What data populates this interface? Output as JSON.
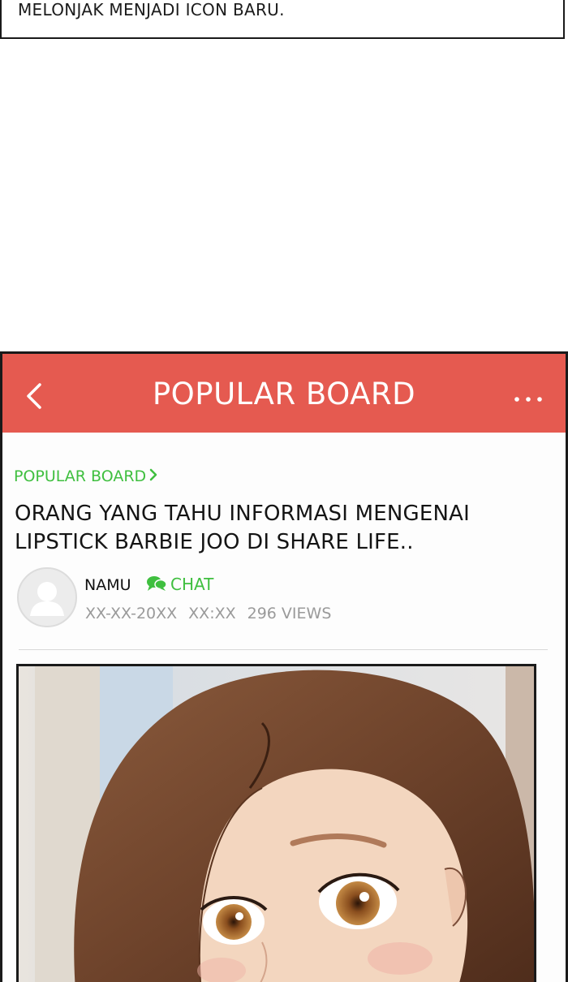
{
  "caption": {
    "text": "MELONJAK MENJADI ICON BARU."
  },
  "appbar": {
    "title": "POPULAR BOARD",
    "back_icon": "chevron-left-icon",
    "more_icon": "more-dots-icon"
  },
  "breadcrumb": {
    "label": "POPULAR BOARD",
    "icon": "chevron-right-icon"
  },
  "post": {
    "title": "ORANG YANG TAHU INFORMASI MENGENAI LIPSTICK BARBIE JOO DI SHARE LIFE..",
    "author": "NAMU",
    "chat_label": "CHAT",
    "date": "XX-XX-20XX",
    "time": "XX:XX",
    "views": "296 VIEWS"
  },
  "colors": {
    "accent": "#e55a50",
    "green": "#3fbf3f",
    "meta": "#9a9a9a"
  }
}
